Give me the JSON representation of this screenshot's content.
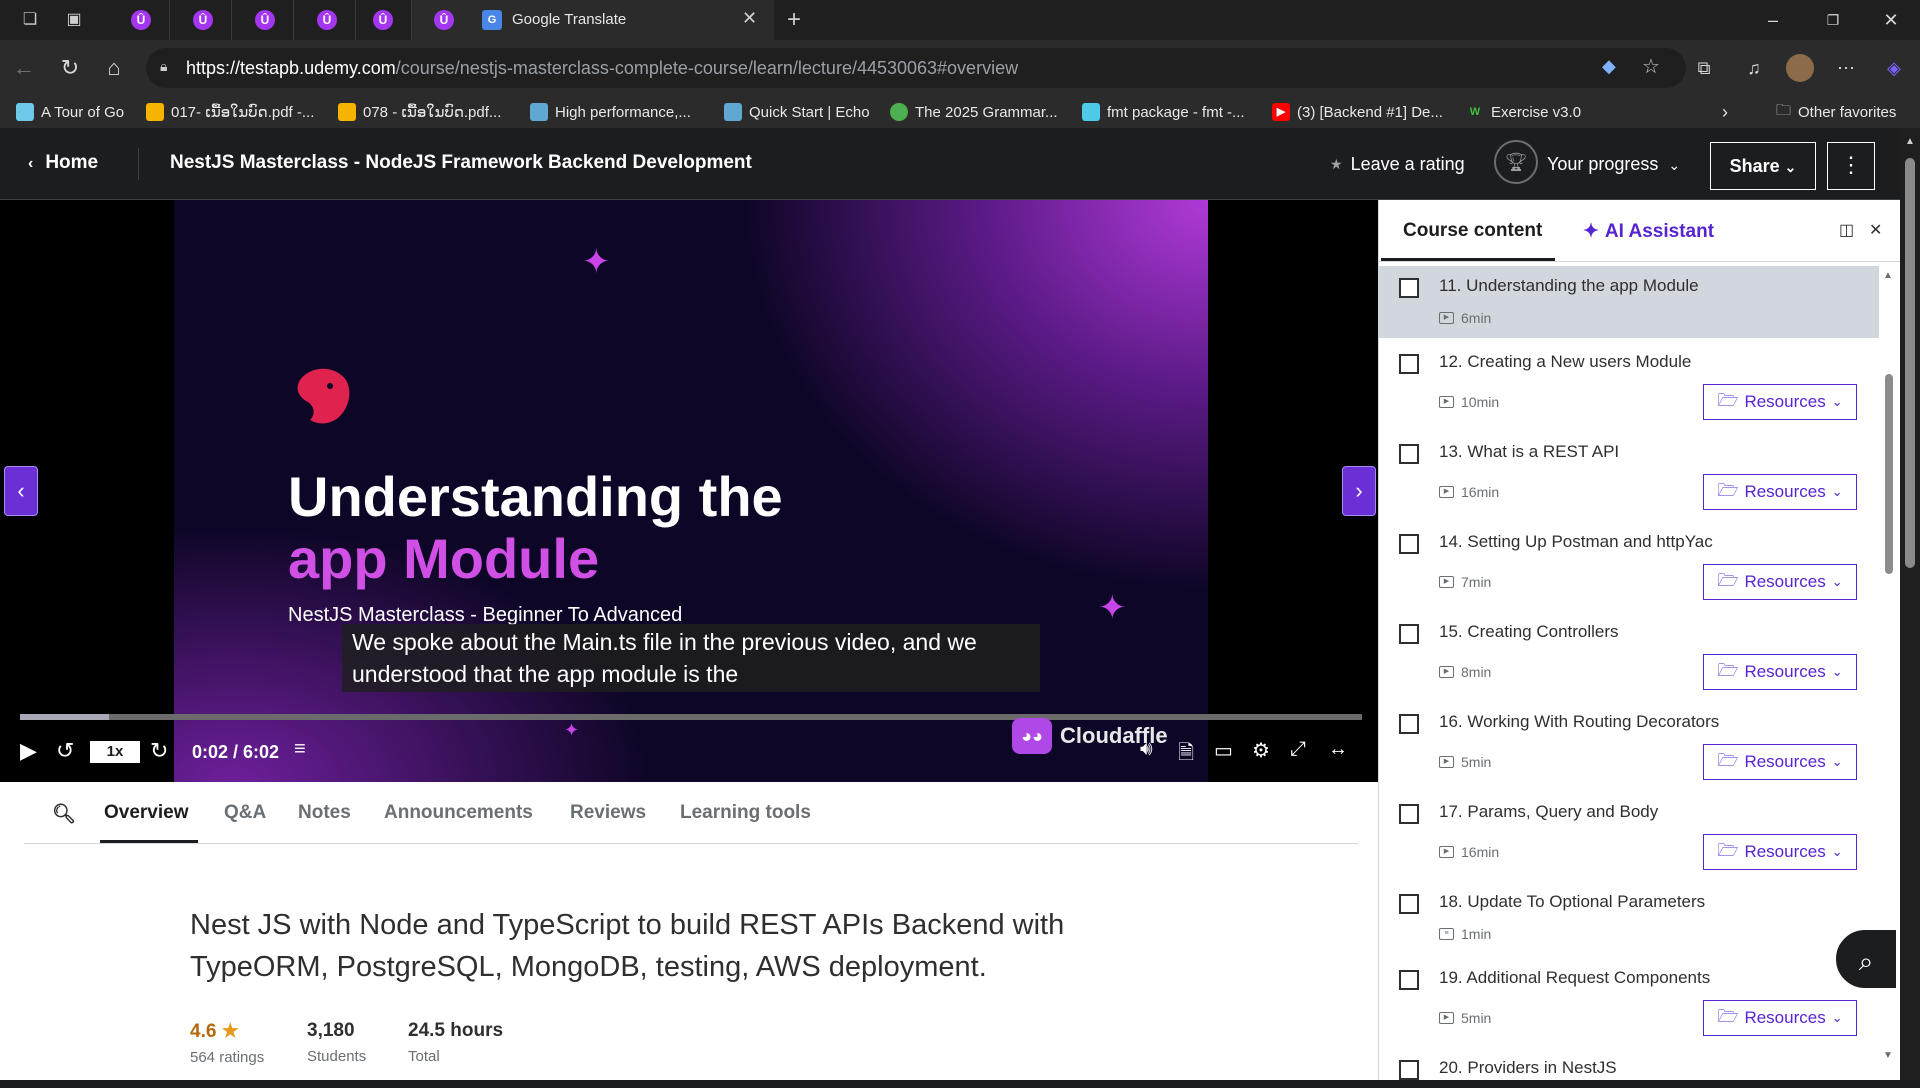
{
  "browser": {
    "tabs": [
      {
        "icon": "udemy-icon"
      },
      {
        "icon": "udemy-icon"
      },
      {
        "icon": "udemy-icon"
      },
      {
        "icon": "udemy-icon"
      },
      {
        "icon": "udemy-icon"
      },
      {
        "icon": "udemy-icon"
      },
      {
        "icon": "google-translate-icon",
        "label": "Google Translate"
      }
    ],
    "udemy_glyph": "Û",
    "translate_glyph": "G",
    "url_host": "https://testapb.udemy.com",
    "url_path": "/course/nestjs-masterclass-complete-course/learn/lecture/44530063#overview",
    "bookmarks": [
      {
        "label": "A Tour of Go",
        "color": "#6ec8e8"
      },
      {
        "label": "017- ເນື້ອໃນບົດ.pdf -...",
        "color": "#f4b400"
      },
      {
        "label": "078 - ເນື້ອໃນບົດ.pdf...",
        "color": "#f4b400"
      },
      {
        "label": "High performance,...",
        "color": "#5fa8d3"
      },
      {
        "label": "Quick Start | Echo",
        "color": "#5fa8d3"
      },
      {
        "label": "The 2025 Grammar...",
        "color": "#4caf50"
      },
      {
        "label": "fmt package - fmt -...",
        "color": "#4ec9e8"
      },
      {
        "label": "(3) [Backend #1] De...",
        "color": "#ff0000"
      },
      {
        "label": "Exercise v3.0",
        "color": "#3a8f3a"
      }
    ],
    "other_favorites": "Other favorites"
  },
  "header": {
    "home": "Home",
    "course_title": "NestJS Masterclass - NodeJS Framework Backend Development",
    "leave_rating": "Leave a rating",
    "your_progress": "Your progress",
    "share": "Share"
  },
  "video": {
    "slide_title_1": "Understanding the",
    "slide_title_2": "app Module",
    "slide_subtitle": "NestJS Masterclass - Beginner To Advanced",
    "caption": "We spoke about the Main.ts file in the previous video, and we understood that the app module is the",
    "speed": "1x",
    "time": "0:02 / 6:02",
    "progress_fraction": 0.066,
    "watermark": "Cloudaffle"
  },
  "tabs": [
    "Overview",
    "Q&A",
    "Notes",
    "Announcements",
    "Reviews",
    "Learning tools"
  ],
  "overview": {
    "title": "Nest JS with Node and TypeScript to build REST APIs Backend with TypeORM, PostgreSQL, MongoDB, testing, AWS deployment.",
    "rating": "4.6",
    "rating_label": "564 ratings",
    "students": "3,180",
    "students_label": "Students",
    "hours": "24.5 hours",
    "hours_label": "Total"
  },
  "sidebar": {
    "course_content": "Course content",
    "ai_assistant": "AI Assistant",
    "resources_label": "Resources",
    "lectures": [
      {
        "title": "11. Understanding the app Module",
        "duration": "6min",
        "resources": false,
        "current": true
      },
      {
        "title": "12. Creating a New users Module",
        "duration": "10min",
        "resources": true
      },
      {
        "title": "13. What is a REST API",
        "duration": "16min",
        "resources": true
      },
      {
        "title": "14. Setting Up Postman and httpYac",
        "duration": "7min",
        "resources": true
      },
      {
        "title": "15. Creating Controllers",
        "duration": "8min",
        "resources": true
      },
      {
        "title": "16. Working With Routing Decorators",
        "duration": "5min",
        "resources": true
      },
      {
        "title": "17. Params, Query and Body",
        "duration": "16min",
        "resources": true
      },
      {
        "title": "18. Update To Optional Parameters",
        "duration": "1min",
        "resources": false,
        "doc": true
      },
      {
        "title": "19. Additional Request Components",
        "duration": "5min",
        "resources": true
      },
      {
        "title": "20. Providers in NestJS",
        "duration": "",
        "resources": false
      }
    ]
  }
}
